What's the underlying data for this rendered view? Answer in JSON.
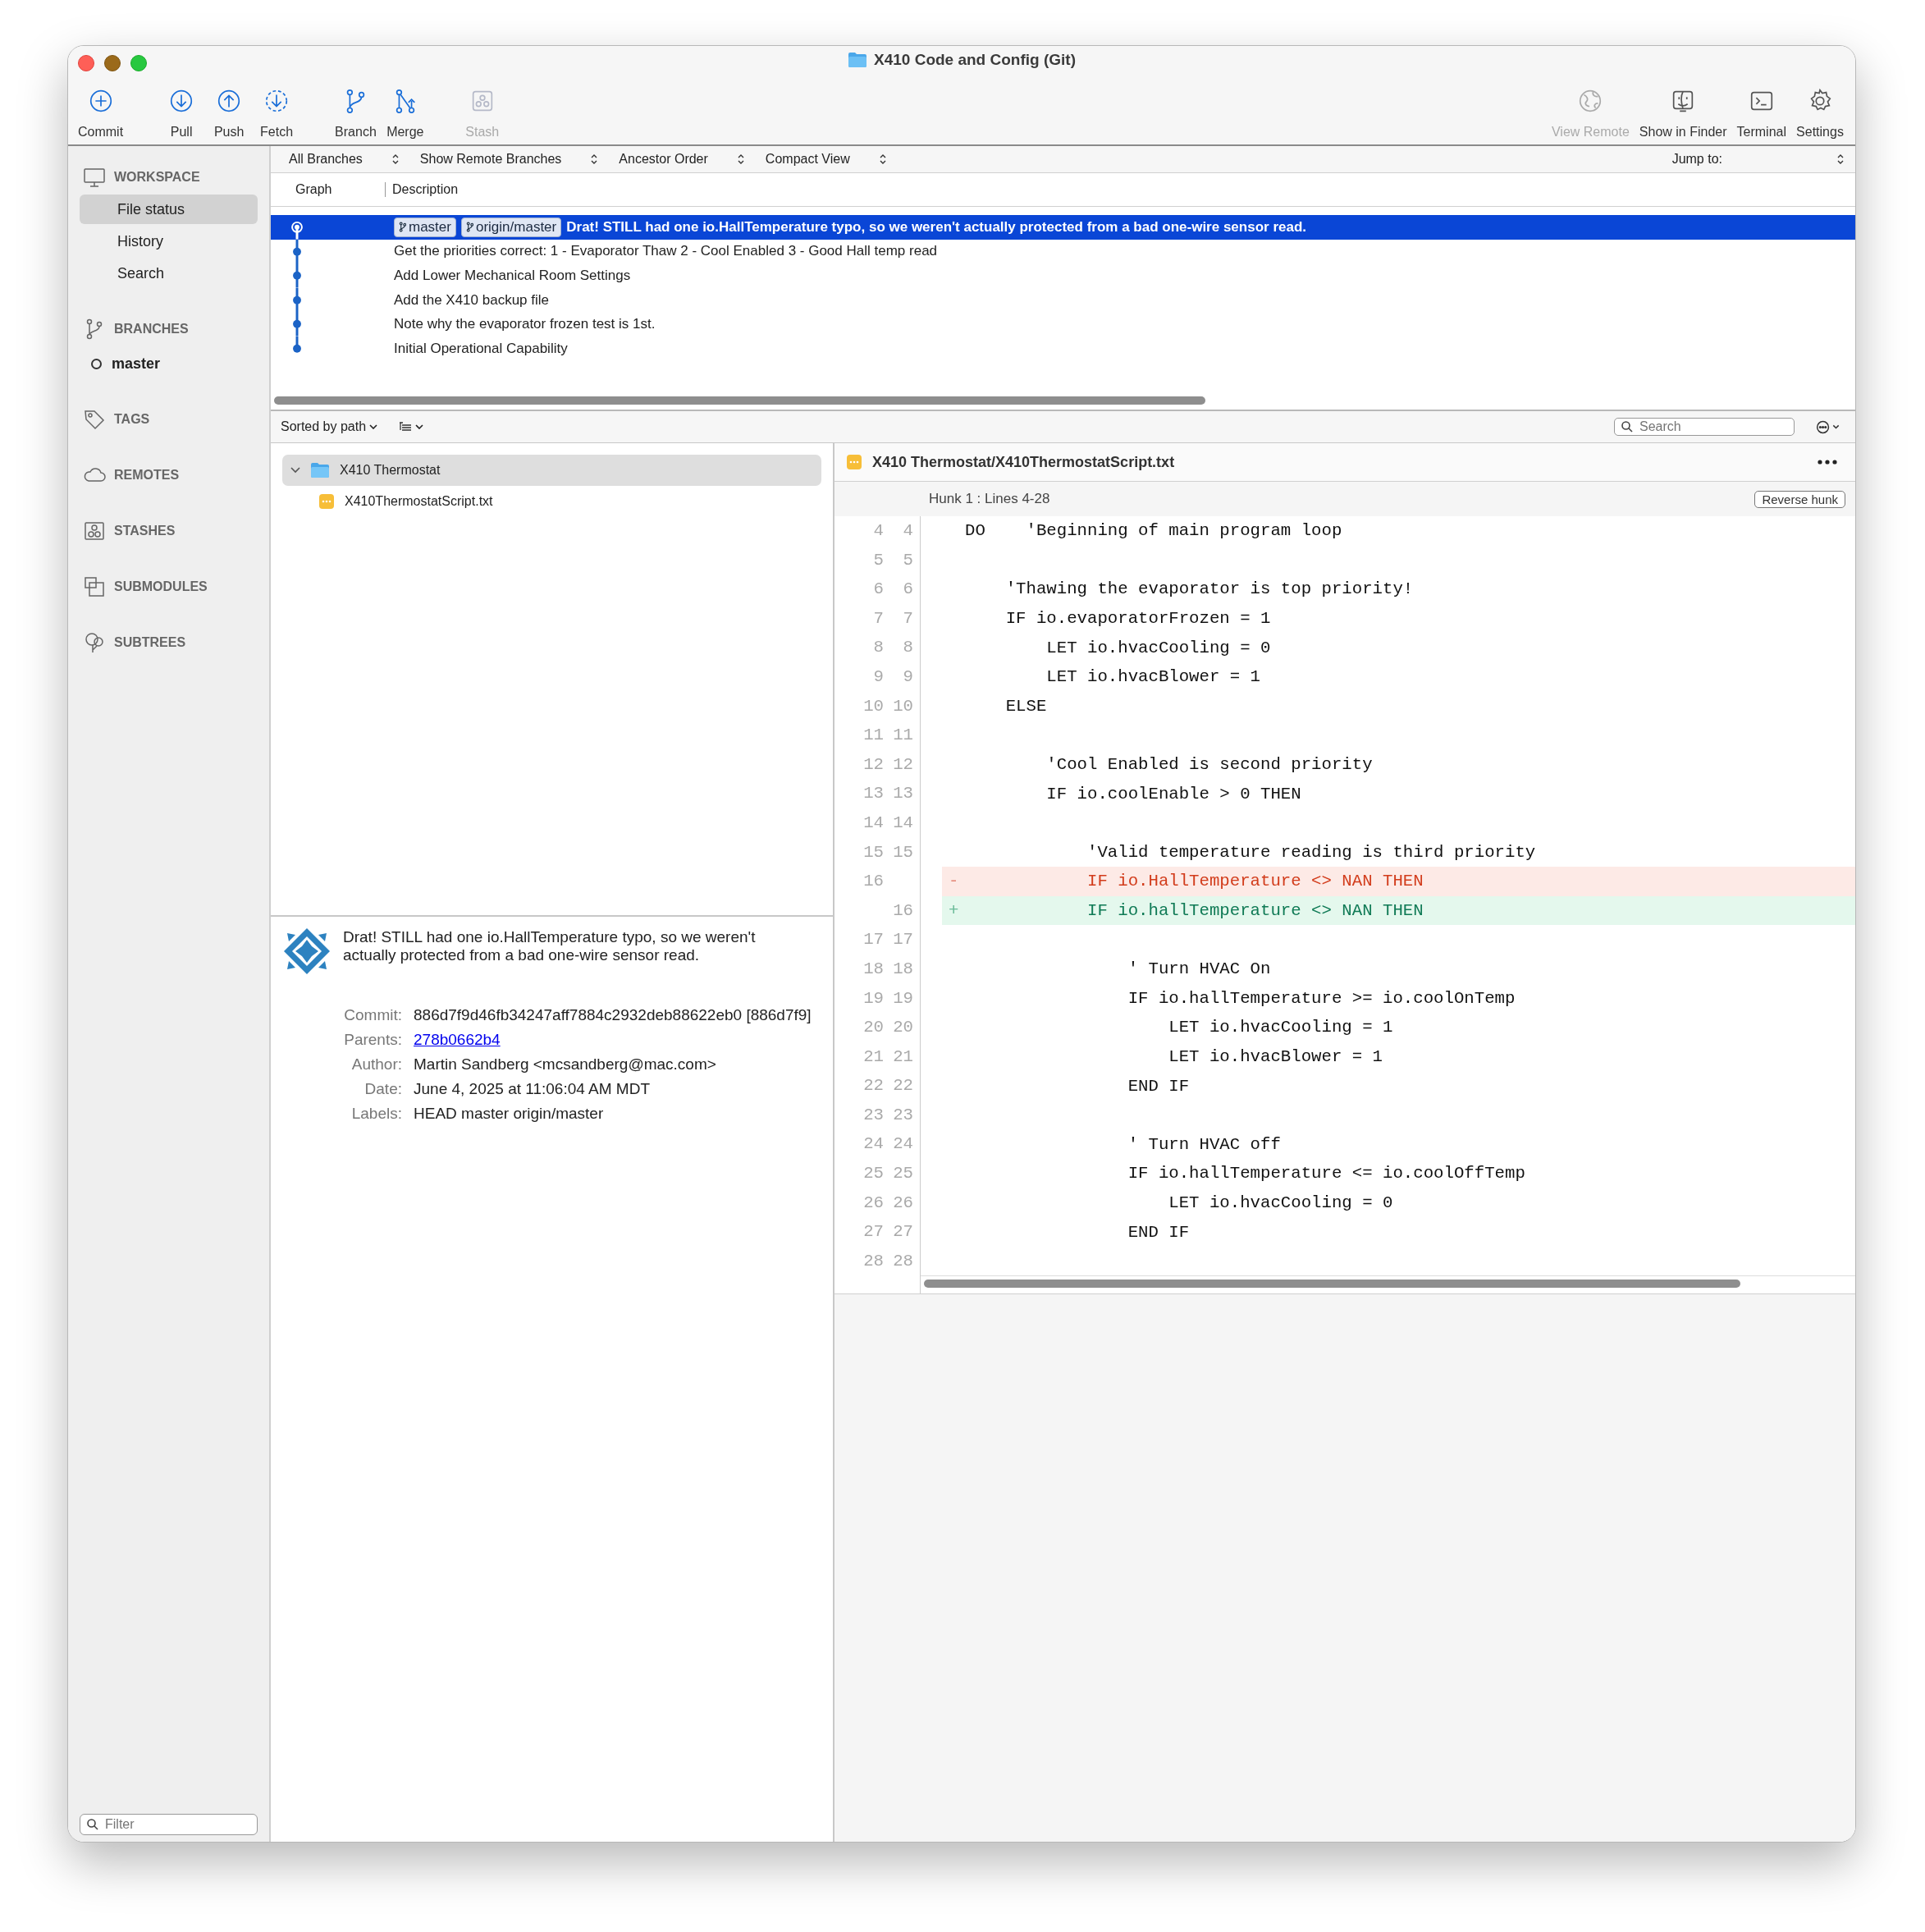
{
  "window": {
    "title": "X410 Code and Config (Git)"
  },
  "toolbar": {
    "left": [
      {
        "label": "Commit",
        "disabled": false
      },
      {
        "label": "Pull",
        "disabled": false
      },
      {
        "label": "Push",
        "disabled": false
      },
      {
        "label": "Fetch",
        "disabled": false
      },
      {
        "label": "Branch",
        "disabled": false
      },
      {
        "label": "Merge",
        "disabled": false
      },
      {
        "label": "Stash",
        "disabled": true
      }
    ],
    "right": [
      {
        "label": "View Remote",
        "disabled": true
      },
      {
        "label": "Show in Finder",
        "disabled": false
      },
      {
        "label": "Terminal",
        "disabled": false
      },
      {
        "label": "Settings",
        "disabled": false
      }
    ]
  },
  "sidebar": {
    "sections": [
      {
        "title": "WORKSPACE",
        "items": [
          {
            "label": "File status",
            "selected": true,
            "current": false
          },
          {
            "label": "History",
            "selected": false,
            "current": false
          },
          {
            "label": "Search",
            "selected": false,
            "current": false
          }
        ]
      },
      {
        "title": "BRANCHES",
        "items": [
          {
            "label": "master",
            "selected": false,
            "current": true
          }
        ]
      },
      {
        "title": "TAGS"
      },
      {
        "title": "REMOTES"
      },
      {
        "title": "STASHES"
      },
      {
        "title": "SUBMODULES"
      },
      {
        "title": "SUBTREES"
      }
    ],
    "filter": {
      "placeholder": "Filter"
    }
  },
  "filter_bar": {
    "dropdowns": [
      "All Branches",
      "Show Remote Branches",
      "Ancestor Order",
      "Compact View"
    ],
    "jump_to": "Jump to:"
  },
  "commit_list": {
    "columns": [
      "Graph",
      "Description"
    ],
    "rows": [
      {
        "description": "Drat! STILL had one io.HallTemperature typo, so we weren't actually protected from a bad one-wire sensor read.",
        "selected": true,
        "head": true,
        "labels": [
          "master",
          "origin/master"
        ]
      },
      {
        "description": "Get the priorities correct: 1 - Evaporator Thaw 2 - Cool Enabled 3 - Good Hall temp read",
        "selected": false,
        "head": false
      },
      {
        "description": "Add Lower Mechanical Room Settings",
        "selected": false,
        "head": false
      },
      {
        "description": "Add the X410 backup file",
        "selected": false,
        "head": false
      },
      {
        "description": "Note why the evaporator frozen test is 1st.",
        "selected": false,
        "head": false
      },
      {
        "description": "Initial Operational Capability",
        "selected": false,
        "head": false
      }
    ]
  },
  "file_toolbar": {
    "sort": "Sorted by path",
    "search": {
      "placeholder": "Search"
    }
  },
  "file_tree": [
    {
      "label": "X410 Thermostat",
      "kind": "folder",
      "expanded": true,
      "selected": true,
      "children": [
        {
          "label": "X410ThermostatScript.txt",
          "kind": "file",
          "selected": false
        }
      ]
    }
  ],
  "commit_details": {
    "message": "Drat! STILL had one io.HallTemperature typo, so we weren't actually protected from a bad one-wire sensor read.",
    "fields": [
      {
        "label": "Commit:",
        "value": "886d7f9d46fb34247aff7884c2932deb88622eb0 [886d7f9]",
        "kind": "text"
      },
      {
        "label": "Parents:",
        "value": "278b0662b4",
        "kind": "link"
      },
      {
        "label": "Author:",
        "value": "Martin Sandberg <mcsandberg@mac.com>",
        "kind": "text"
      },
      {
        "label": "Date:",
        "value": "June 4, 2025 at 11:06:04 AM MDT",
        "kind": "text"
      },
      {
        "label": "Labels:",
        "value": "HEAD master origin/master",
        "kind": "text"
      }
    ]
  },
  "diff": {
    "file": "X410 Thermostat/X410ThermostatScript.txt",
    "hunk": "Hunk 1 : Lines 4-28",
    "reverse_button": "Reverse hunk",
    "lines": [
      {
        "old": "4",
        "new": "4",
        "kind": "context",
        "text": "DO    'Beginning of main program loop"
      },
      {
        "old": "5",
        "new": "5",
        "kind": "context"
      },
      {
        "old": "6",
        "new": "6",
        "kind": "context",
        "text": "    'Thawing the evaporator is top priority!"
      },
      {
        "old": "7",
        "new": "7",
        "kind": "context",
        "text": "    IF io.evaporatorFrozen = 1"
      },
      {
        "old": "8",
        "new": "8",
        "kind": "context",
        "text": "        LET io.hvacCooling = 0"
      },
      {
        "old": "9",
        "new": "9",
        "kind": "context",
        "text": "        LET io.hvacBlower = 1"
      },
      {
        "old": "10",
        "new": "10",
        "kind": "context",
        "text": "    ELSE"
      },
      {
        "old": "11",
        "new": "11",
        "kind": "context"
      },
      {
        "old": "12",
        "new": "12",
        "kind": "context",
        "text": "        'Cool Enabled is second priority"
      },
      {
        "old": "13",
        "new": "13",
        "kind": "context",
        "text": "        IF io.coolEnable > 0 THEN"
      },
      {
        "old": "14",
        "new": "14",
        "kind": "context"
      },
      {
        "old": "15",
        "new": "15",
        "kind": "context",
        "text": "            'Valid temperature reading is third priority"
      },
      {
        "old": "16",
        "kind": "removed",
        "sign": "-",
        "text": "            IF io.HallTemperature <> NAN THEN"
      },
      {
        "new": "16",
        "kind": "added",
        "sign": "+",
        "text": "            IF io.hallTemperature <> NAN THEN"
      },
      {
        "old": "17",
        "new": "17",
        "kind": "context"
      },
      {
        "old": "18",
        "new": "18",
        "kind": "context",
        "text": "                ' Turn HVAC On"
      },
      {
        "old": "19",
        "new": "19",
        "kind": "context",
        "text": "                IF io.hallTemperature >= io.coolOnTemp"
      },
      {
        "old": "20",
        "new": "20",
        "kind": "context",
        "text": "                    LET io.hvacCooling = 1"
      },
      {
        "old": "21",
        "new": "21",
        "kind": "context",
        "text": "                    LET io.hvacBlower = 1"
      },
      {
        "old": "22",
        "new": "22",
        "kind": "context",
        "text": "                END IF"
      },
      {
        "old": "23",
        "new": "23",
        "kind": "context"
      },
      {
        "old": "24",
        "new": "24",
        "kind": "context",
        "text": "                ' Turn HVAC off"
      },
      {
        "old": "25",
        "new": "25",
        "kind": "context",
        "text": "                IF io.hallTemperature <= io.coolOffTemp"
      },
      {
        "old": "26",
        "new": "26",
        "kind": "context",
        "text": "                    LET io.hvacCooling = 0"
      },
      {
        "old": "27",
        "new": "27",
        "kind": "context",
        "text": "                END IF"
      },
      {
        "old": "28",
        "new": "28",
        "kind": "context"
      }
    ]
  }
}
